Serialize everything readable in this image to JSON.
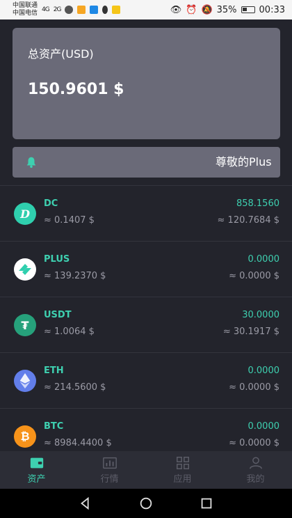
{
  "status_bar": {
    "carrier_1": "中国联通",
    "carrier_2": "中国电信",
    "signal_1": "4G",
    "signal_2": "2G",
    "battery": "35%",
    "time": "00:33"
  },
  "balance_card": {
    "label": "总资产(USD)",
    "value": "150.9601 $"
  },
  "notice": {
    "text": "尊敬的Plus"
  },
  "assets": [
    {
      "name": "DC",
      "icon_color": "#2fcfae",
      "icon_glyph": "D",
      "price": "≈ 0.1407 $",
      "amount": "858.1560",
      "value": "≈ 120.7684 $"
    },
    {
      "name": "PLUS",
      "icon_color": "#ffffff",
      "icon_glyph": "",
      "price": "≈ 139.2370 $",
      "amount": "0.0000",
      "value": "≈ 0.0000 $"
    },
    {
      "name": "USDT",
      "icon_color": "#26a17b",
      "icon_glyph": "₮",
      "price": "≈ 1.0064 $",
      "amount": "30.0000",
      "value": "≈ 30.1917 $"
    },
    {
      "name": "ETH",
      "icon_color": "#627eea",
      "icon_glyph": "",
      "price": "≈ 214.5600 $",
      "amount": "0.0000",
      "value": "≈ 0.0000 $"
    },
    {
      "name": "BTC",
      "icon_color": "#f7931a",
      "icon_glyph": "₿",
      "price": "≈ 8984.4400 $",
      "amount": "0.0000",
      "value": "≈ 0.0000 $"
    }
  ],
  "tabs": [
    {
      "label": "资产",
      "icon": "wallet-icon",
      "active": true
    },
    {
      "label": "行情",
      "icon": "chart-icon",
      "active": false
    },
    {
      "label": "应用",
      "icon": "grid-icon",
      "active": false
    },
    {
      "label": "我的",
      "icon": "user-icon",
      "active": false
    }
  ],
  "colors": {
    "accent": "#3ed0b0",
    "background": "#23242c",
    "card": "#6a6a78"
  }
}
